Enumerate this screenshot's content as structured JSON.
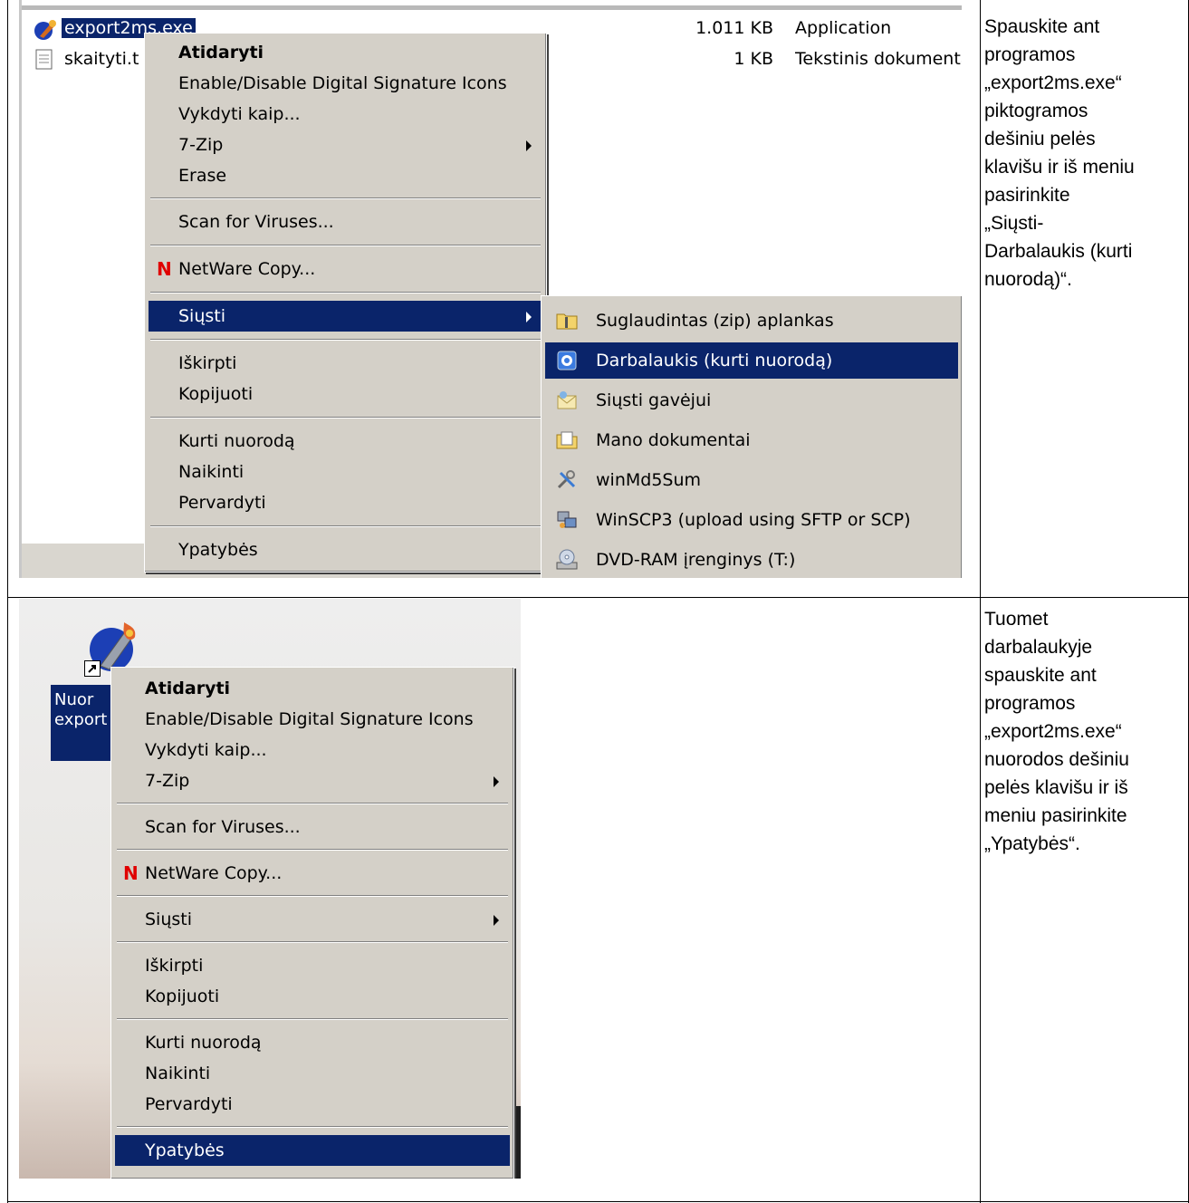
{
  "screenshot1": {
    "files": [
      {
        "name": "export2ms.exe",
        "size": "1.011 KB",
        "type": "Application"
      },
      {
        "name": "skaityti.t",
        "size": "1 KB",
        "type": "Tekstinis dokumenta"
      }
    ],
    "menu": {
      "items": [
        {
          "label": "Atidaryti"
        },
        {
          "label": "Enable/Disable Digital Signature Icons"
        },
        {
          "label": "Vykdyti kaip..."
        },
        {
          "label": "7-Zip"
        },
        {
          "label": "Erase"
        },
        {
          "label": "Scan for Viruses..."
        },
        {
          "label": "NetWare Copy..."
        },
        {
          "label": "Siųsti"
        },
        {
          "label": "Iškirpti"
        },
        {
          "label": "Kopijuoti"
        },
        {
          "label": "Kurti nuorodą"
        },
        {
          "label": "Naikinti"
        },
        {
          "label": "Pervardyti"
        },
        {
          "label": "Ypatybės"
        }
      ],
      "n_mark": "N"
    },
    "submenu": {
      "items": [
        {
          "label": "Suglaudintas (zip) aplankas",
          "icon": "zip-folder-icon"
        },
        {
          "label": "Darbalaukis (kurti nuorodą)",
          "icon": "desktop-icon"
        },
        {
          "label": "Siųsti  gavėjui",
          "icon": "mail-recipient-icon"
        },
        {
          "label": "Mano dokumentai",
          "icon": "my-documents-icon"
        },
        {
          "label": "winMd5Sum",
          "icon": "tools-icon"
        },
        {
          "label": "WinSCP3 (upload using SFTP or SCP)",
          "icon": "winscp-icon"
        },
        {
          "label": "DVD-RAM įrenginys (T:)",
          "icon": "dvd-drive-icon"
        }
      ]
    }
  },
  "screenshot2": {
    "desktop_label": "Nuor\nexport",
    "menu": {
      "items": [
        {
          "label": "Atidaryti"
        },
        {
          "label": "Enable/Disable Digital Signature Icons"
        },
        {
          "label": "Vykdyti kaip..."
        },
        {
          "label": "7-Zip"
        },
        {
          "label": "Scan for Viruses..."
        },
        {
          "label": "NetWare Copy..."
        },
        {
          "label": "Siųsti"
        },
        {
          "label": "Iškirpti"
        },
        {
          "label": "Kopijuoti"
        },
        {
          "label": "Kurti nuorodą"
        },
        {
          "label": "Naikinti"
        },
        {
          "label": "Pervardyti"
        },
        {
          "label": "Ypatybės"
        }
      ],
      "n_mark": "N"
    }
  },
  "instructions": [
    "Spauskite ant\nprogramos\n„export2ms.exe“\npiktogramos\ndešiniu pelės\nklavišu ir iš meniu\npasirinkite\n„Siųsti-\nDarbalaukis (kurti\nnuorodą)“.",
    "Tuomet\ndarbalaukyje\nspauskite ant\nprogramos\n„export2ms.exe“\nnuorodos dešiniu\npelės klavišu ir iš\nmeniu pasirinkite\n„Ypatybės“."
  ],
  "colors": {
    "menu_bg": "#d4d0c8",
    "selection": "#0a246a",
    "netware_red": "#e00000"
  }
}
